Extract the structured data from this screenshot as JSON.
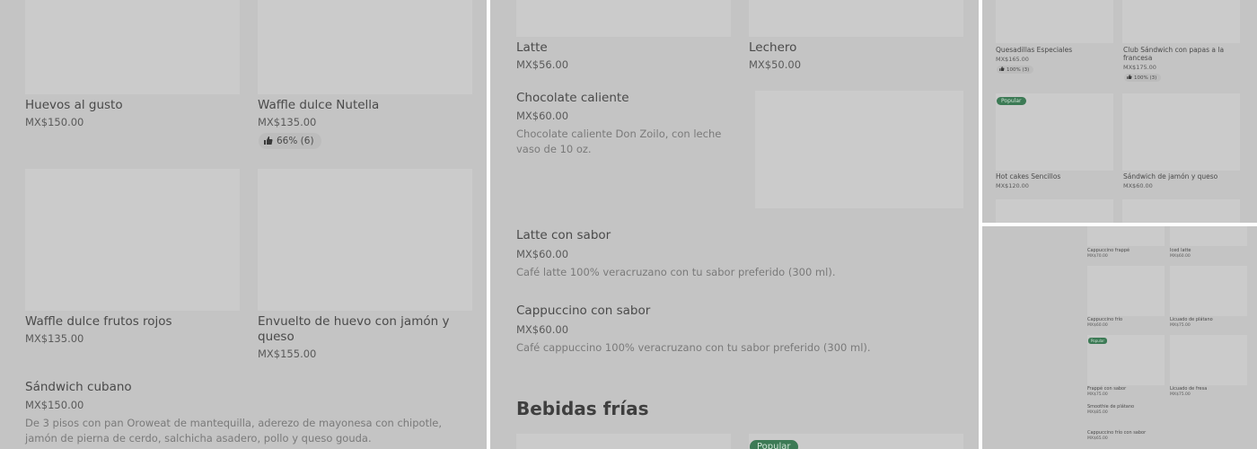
{
  "panel1": {
    "items": [
      {
        "name": "Huevos al gusto",
        "price": "MX$150.00"
      },
      {
        "name": "Waffle dulce Nutella",
        "price": "MX$135.00",
        "rating": "66% (6)"
      },
      {
        "name": "Waffle dulce frutos rojos",
        "price": "MX$135.00"
      },
      {
        "name": "Envuelto de huevo con jamón y queso",
        "price": "MX$155.00"
      },
      {
        "name": "Sándwich cubano",
        "price": "MX$150.00",
        "description": "De 3 pisos con pan Oroweat de mantequilla, aderezo de mayonesa con chipotle, jamón de pierna de cerdo, salchicha asadero, pollo y queso gouda."
      }
    ]
  },
  "panel2": {
    "items": [
      {
        "name": "Latte",
        "price": "MX$56.00"
      },
      {
        "name": "Lechero",
        "price": "MX$50.00"
      },
      {
        "name": "Chocolate caliente",
        "price": "MX$60.00",
        "description": "Chocolate caliente Don Zoilo, con leche vaso de 10 oz."
      },
      {
        "name": "Latte con sabor",
        "price": "MX$60.00",
        "description": "Café latte 100% veracruzano con tu sabor preferido (300 ml)."
      },
      {
        "name": "Cappuccino con sabor",
        "price": "MX$60.00",
        "description": "Café cappuccino 100% veracruzano con tu sabor preferido (300 ml)."
      }
    ],
    "section_heading": "Bebidas frías",
    "popular_badge": "Popular"
  },
  "panel3": {
    "items": [
      {
        "name": "Quesadillas Especiales",
        "price": "MX$165.00",
        "rating": "100% (3)"
      },
      {
        "name": "Club Sándwich con papas a la francesa",
        "price": "MX$175.00",
        "rating": "100% (3)"
      },
      {
        "name": "Hot cakes Sencillos",
        "price": "MX$120.00"
      },
      {
        "name": "Sándwich de jamón y queso",
        "price": "MX$60.00"
      }
    ],
    "popular_badge": "Popular"
  },
  "panel4": {
    "items": [
      {
        "name": "Cappuccino frappé",
        "price": "MX$70.00"
      },
      {
        "name": "Iced latte",
        "price": "MX$60.00"
      },
      {
        "name": "Cappuccino frío",
        "price": "MX$60.00"
      },
      {
        "name": "Licuado de plátano",
        "price": "MX$75.00"
      },
      {
        "name": "Frappé con sabor",
        "price": "MX$75.00"
      },
      {
        "name": "Licuado de fresa",
        "price": "MX$75.00"
      },
      {
        "name": "Smoothie de plátano",
        "price": "MX$85.00"
      },
      {
        "name": "Cappuccino frío con sabor",
        "price": "MX$65.00"
      }
    ],
    "popular_badge": "Popular"
  },
  "colors": {
    "panel_bg": "#c4c4c4",
    "placeholder": "#cbcbcb",
    "badge_green": "#3c7a55"
  },
  "icons": {
    "rating": "thumbs-up-icon"
  }
}
